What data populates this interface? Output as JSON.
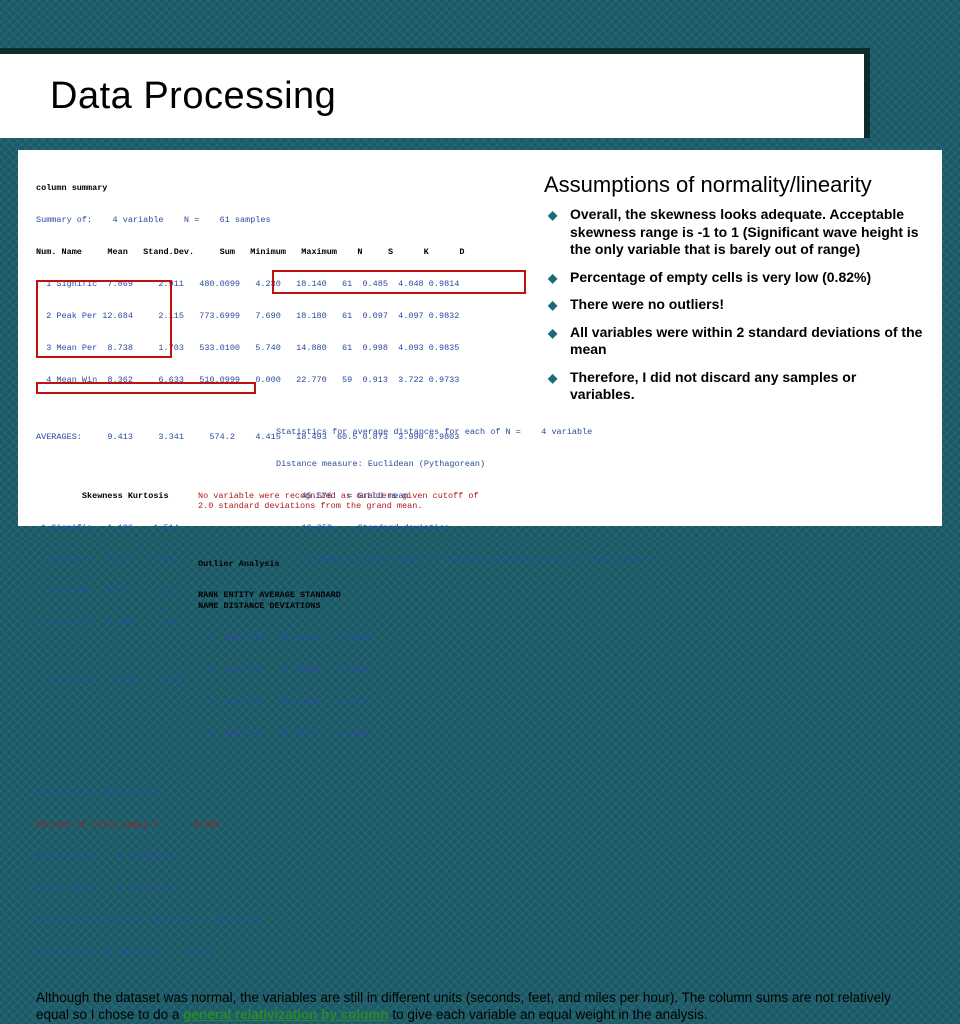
{
  "title": "Data Processing",
  "subhead": "Assumptions of normality/linearity",
  "bullets": [
    "Overall, the skewness looks adequate. Acceptable skewness range is -1 to 1 (Significant wave height is the only variable that is barely out of range)",
    "Percentage of empty cells is very low (0.82%)",
    "There were no outliers!",
    "All variables were within 2 standard deviations of the mean",
    "Therefore, I did not discard any samples or variables."
  ],
  "footer_pre": "Although the dataset was normal, the variables are still in different units (seconds, feet, and miles per hour). The column sums are not relatively equal so I chose to do a ",
  "footer_hl": "general relativization by column",
  "footer_post": " to give each variable an equal weight in the analysis.",
  "summary_caption": "column summary",
  "summary_line": "Summary of:    4 variable    N =    61 samples",
  "summary_header": "Num. Name     Mean   Stand.Dev.     Sum   Minimum   Maximum    N     S      K      D",
  "summary_rows": [
    "  1 Signific  7.869     2.911   480.0099   4.230   18.140   61  0.485  4.048 0.9814",
    "  2 Peak Per 12.684     2.115   773.6999   7.690   18.180   61  0.097  4.097 0.9832",
    "  3 Mean Per  8.738     1.703   533.0100   5.740   14.880   61  0.998  4.093 0.9835",
    "  4 Mean Win  8.362     6.633   510.0999   0.000   22.770   59  0.913  3.722 0.9733"
  ],
  "summary_avg": "AVERAGES:     9.413     3.341     574.2    4.415   18.493  60.5 0.873  3.990 0.9803",
  "sk_header": "         Skewness Kurtosis",
  "sk_rows": [
    " 1 Signific   1.136    1.514",
    " 2 Peak Per   0.029   -0.094",
    " 3 Mean Per   0.825    1.111",
    " 4 Mean Win   0.099   -1.280"
  ],
  "sk_avg": "   Averages:   0.522    0.323",
  "matrix_stats": [
    "244 cells in main matrix",
    "Percent of cells empty =       0.820",
    "Matrix total =  0.22968E+04",
    "Matrix mean  =  0.94132E+01",
    "Variance of totals of variable = 0.18159E+05",
    "CV of totals of variable =   23.47%"
  ],
  "outlier_note": "No variable were recognized as outliers given cutoff of\n 2.0 standard deviations from the grand mean.",
  "outlier_title": "Outlier Analysis",
  "outlier_header": "RANK   ENTITY    AVERAGE   STANDARD\n        NAME    DISTANCE  DEVIATIONS",
  "outlier_rows": [
    "  1  Mean Win   58.94614   1.32849",
    "  2  Peak Per   47.03990   0.20525",
    "  3  Signific   38.65838  -0.68776",
    "  4  Mean Per   37.05717  -0.84696"
  ],
  "outlier_footer": [
    "Statistics for average distances for each of N =    4 variable",
    "Distance measure: Euclidean (Pythagorean)",
    "     45.576   = Grand mean",
    "     10.058   = Standard deviation",
    "      2.00000 = Cutoff number of standard deviations used to flag outliers"
  ]
}
